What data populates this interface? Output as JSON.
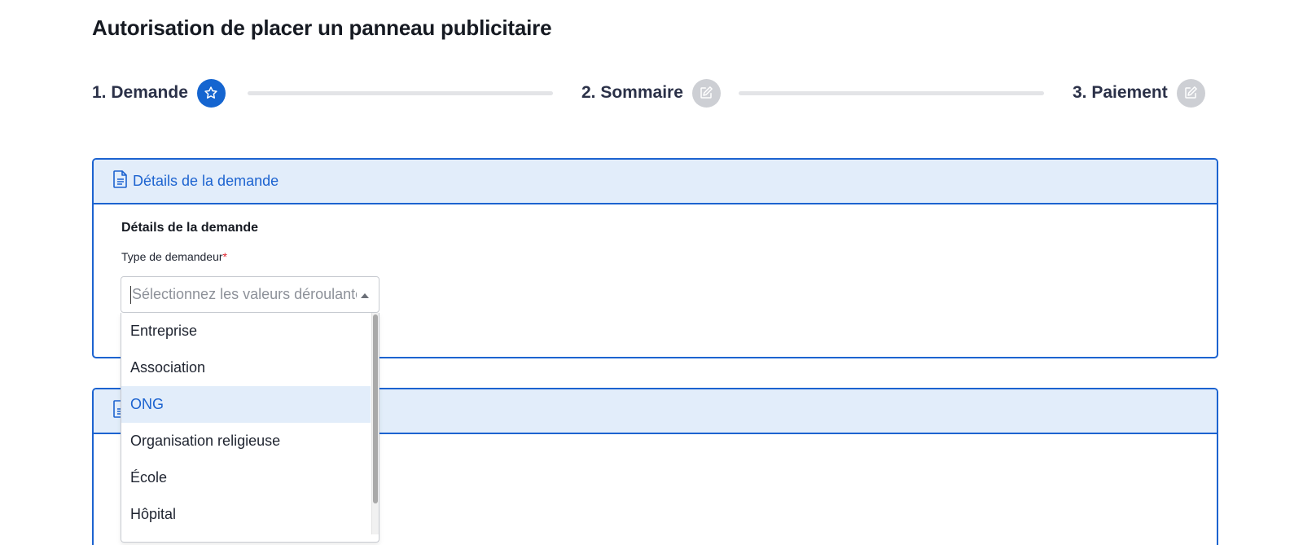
{
  "page": {
    "title": "Autorisation de placer un panneau publicitaire"
  },
  "stepper": {
    "steps": [
      {
        "label": "1. Demande",
        "icon": "star-icon",
        "state": "active"
      },
      {
        "label": "2. Sommaire",
        "icon": "edit-icon",
        "state": "inactive"
      },
      {
        "label": "3. Paiement",
        "icon": "edit-icon",
        "state": "inactive"
      }
    ]
  },
  "panel1": {
    "header_title": "Détails de la demande",
    "header_icon": "document-icon",
    "section_title": "Détails de la demande",
    "field_label": "Type de demandeur",
    "required_mark": "*"
  },
  "panel2": {
    "header_icon": "document-icon"
  },
  "select": {
    "placeholder": "Sélectionnez les valeurs déroulantes",
    "open": true
  },
  "dropdown": {
    "options": [
      "Entreprise",
      "Association",
      "ONG",
      "Organisation religieuse",
      "École",
      "Hôpital"
    ],
    "highlighted": "ONG"
  },
  "colors": {
    "accent": "#1c63d0",
    "header_bg": "#e2edfa",
    "inactive_step": "#cdcfd4",
    "required": "#e0212b"
  }
}
